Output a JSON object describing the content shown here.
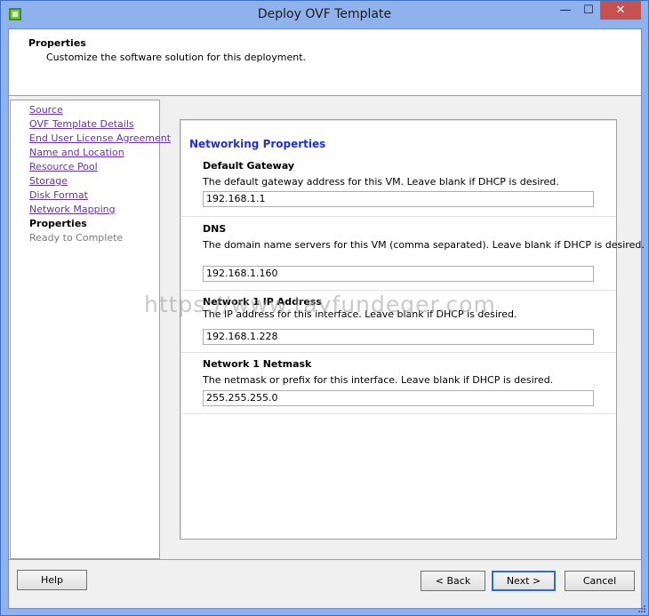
{
  "window": {
    "title": "Deploy OVF Template",
    "minimize_glyph": "—",
    "maximize_glyph": "☐",
    "close_glyph": "✕"
  },
  "header": {
    "title": "Properties",
    "subtitle": "Customize the software solution for this deployment."
  },
  "nav": {
    "items": [
      {
        "label": "Source",
        "state": "link"
      },
      {
        "label": "OVF Template Details",
        "state": "link"
      },
      {
        "label": "End User License Agreement",
        "state": "link"
      },
      {
        "label": "Name and Location",
        "state": "link"
      },
      {
        "label": "Resource Pool",
        "state": "link"
      },
      {
        "label": "Storage",
        "state": "link"
      },
      {
        "label": "Disk Format",
        "state": "link"
      },
      {
        "label": "Network Mapping",
        "state": "link"
      },
      {
        "label": "Properties",
        "state": "current"
      },
      {
        "label": "Ready to Complete",
        "state": "disabled"
      }
    ]
  },
  "networking": {
    "title": "Networking Properties",
    "fields": [
      {
        "label": "Default Gateway",
        "description": "The default gateway address for this VM. Leave blank if DHCP is desired.",
        "value": "192.168.1.1"
      },
      {
        "label": "DNS",
        "description": "The domain name servers for this VM (comma separated). Leave blank if DHCP is desired.",
        "value": "192.168.1.160"
      },
      {
        "label": "Network 1 IP Address",
        "description": "The IP address for this interface. Leave blank if DHCP is desired.",
        "value": "192.168.1.228"
      },
      {
        "label": "Network 1 Netmask",
        "description": "The netmask or prefix for this interface. Leave blank if DHCP is desired.",
        "value": "255.255.255.0"
      }
    ]
  },
  "watermark": "https://www.tayfundeger.com",
  "buttons": {
    "help": "Help",
    "back": "< Back",
    "next": "Next >",
    "cancel": "Cancel"
  },
  "colors": {
    "title_bar": "#8fb2ed",
    "section_title": "#1f2fd6",
    "nav_link": "#6b2fb3",
    "close_button": "#c75050"
  }
}
